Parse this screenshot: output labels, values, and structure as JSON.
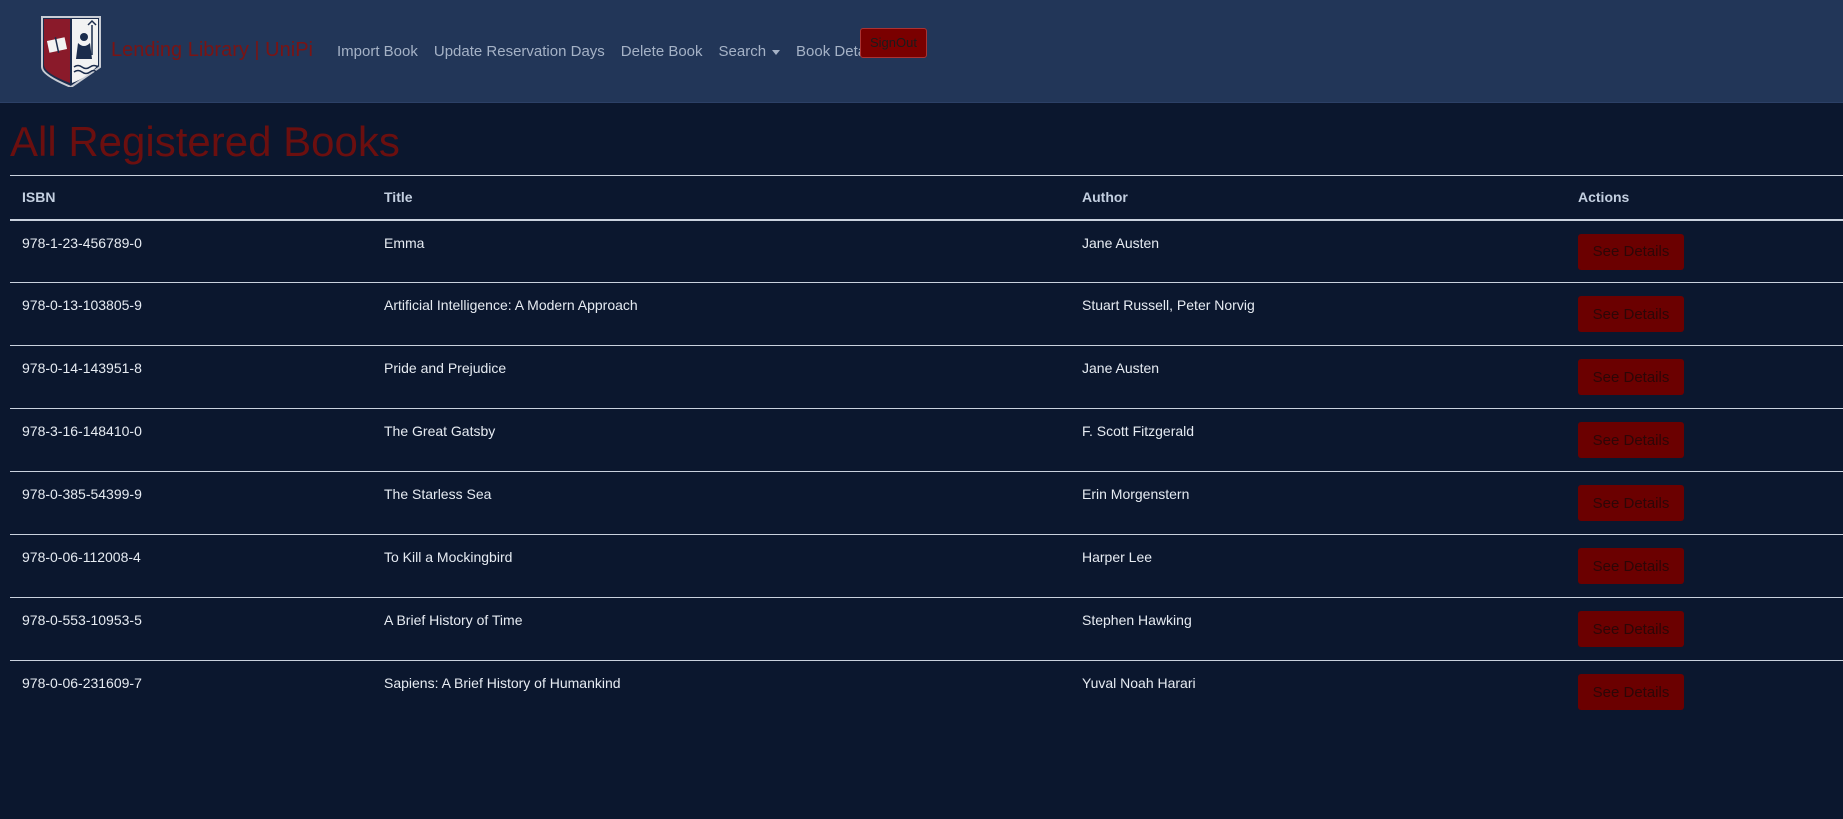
{
  "brand": {
    "name": "Lending Library | UniPi",
    "logo_icon": "university-crest-icon"
  },
  "nav": {
    "items": [
      {
        "label": "Import Book"
      },
      {
        "label": "Update Reservation Days"
      },
      {
        "label": "Delete Book"
      },
      {
        "label": "Search",
        "has_dropdown": true
      },
      {
        "label": "Book Details"
      }
    ],
    "signout_label": "SignOut"
  },
  "page": {
    "title": "All Registered Books"
  },
  "table": {
    "headers": [
      "ISBN",
      "Title",
      "Author",
      "Actions"
    ],
    "action_label": "See Details",
    "rows": [
      {
        "isbn": "978-1-23-456789-0",
        "title": "Emma",
        "author": "Jane Austen"
      },
      {
        "isbn": "978-0-13-103805-9",
        "title": "Artificial Intelligence: A Modern Approach",
        "author": "Stuart Russell, Peter Norvig"
      },
      {
        "isbn": "978-0-14-143951-8",
        "title": "Pride and Prejudice",
        "author": "Jane Austen"
      },
      {
        "isbn": "978-3-16-148410-0",
        "title": "The Great Gatsby",
        "author": "F. Scott Fitzgerald"
      },
      {
        "isbn": "978-0-385-54399-9",
        "title": "The Starless Sea",
        "author": "Erin Morgenstern"
      },
      {
        "isbn": "978-0-06-112008-4",
        "title": "To Kill a Mockingbird",
        "author": "Harper Lee"
      },
      {
        "isbn": "978-0-553-10953-5",
        "title": "A Brief History of Time",
        "author": "Stephen Hawking"
      },
      {
        "isbn": "978-0-06-231609-7",
        "title": "Sapiens: A Brief History of Humankind",
        "author": "Yuval Noah Harari"
      }
    ]
  },
  "colors": {
    "background": "#0b172e",
    "navbar": "#223658",
    "accent_red": "#7a0000",
    "title_red": "#6b0f0f"
  }
}
